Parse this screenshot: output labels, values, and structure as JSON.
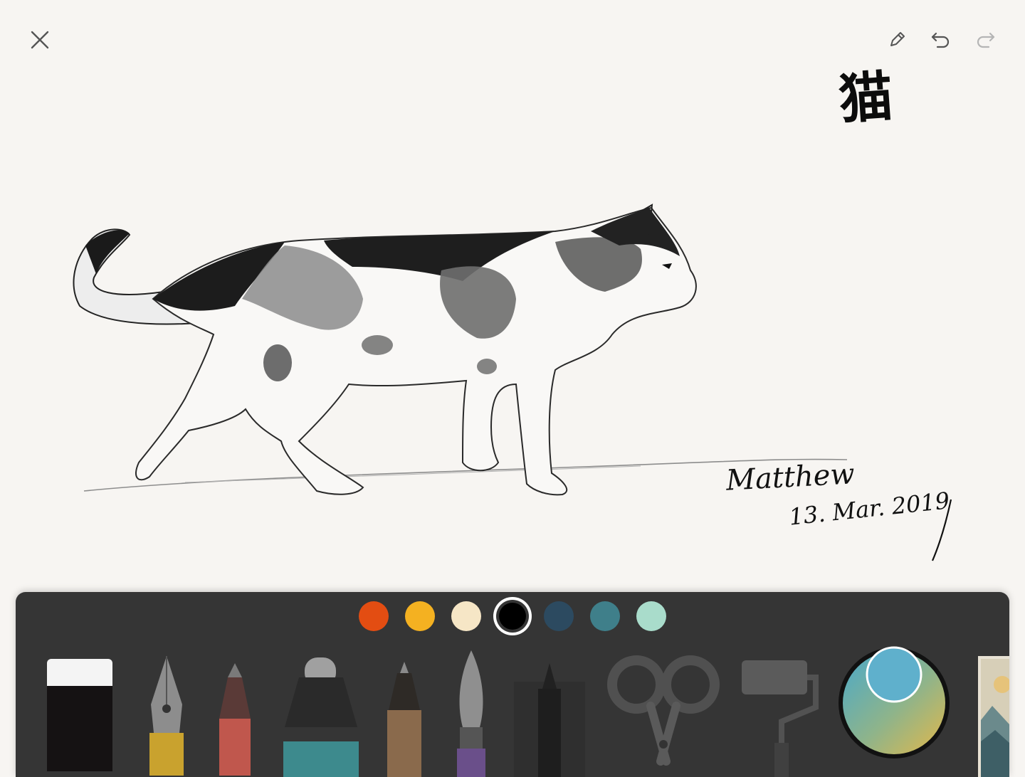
{
  "header": {
    "close_icon": "close-icon",
    "pencil_icon": "pencil-icon",
    "undo_icon": "undo-icon",
    "redo_icon": "redo-icon"
  },
  "canvas": {
    "title_calligraphy": "猫",
    "signature_name": "Matthew",
    "signature_date": "13. Mar. 2019"
  },
  "palette": {
    "colors": [
      "#e34d12",
      "#f4b121",
      "#f6e6c6",
      "#000000",
      "#2c4a60",
      "#3f7f8a",
      "#a9dccb"
    ],
    "selected_index": 3
  },
  "tools": {
    "items": [
      "eraser",
      "fountain-pen",
      "pencil",
      "marker",
      "outliner",
      "watercolor-brush",
      "ink-pen",
      "scissors",
      "paint-roller",
      "color-mixer",
      "gallery-thumbnail"
    ]
  },
  "color_mixer": {
    "current_color": "#5fb0cc"
  }
}
